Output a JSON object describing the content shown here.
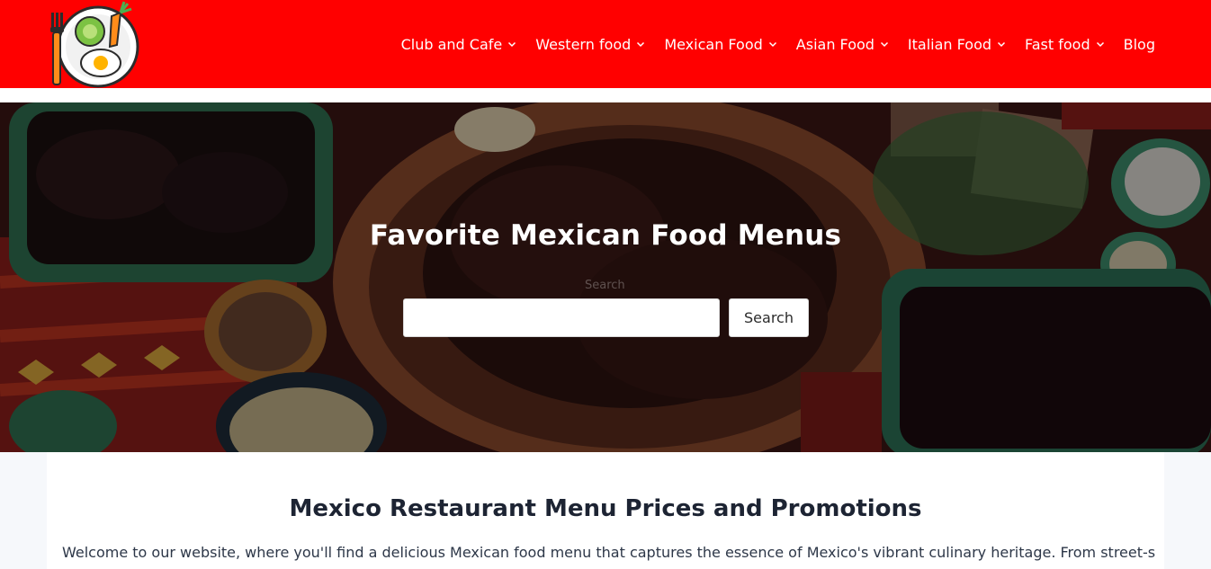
{
  "header": {
    "background": "#ff0000",
    "logo_icon": "food-plate-logo-icon",
    "nav": [
      {
        "label": "Club and Cafe",
        "has_dropdown": true
      },
      {
        "label": "Western food",
        "has_dropdown": true
      },
      {
        "label": "Mexican Food",
        "has_dropdown": true
      },
      {
        "label": "Asian Food",
        "has_dropdown": true
      },
      {
        "label": "Italian Food",
        "has_dropdown": true
      },
      {
        "label": "Fast food",
        "has_dropdown": true
      },
      {
        "label": "Blog",
        "has_dropdown": false
      }
    ]
  },
  "hero": {
    "title": "Favorite Mexican Food Menus",
    "search_label": "Search",
    "search_value": "",
    "search_button": "Search"
  },
  "content": {
    "heading": "Mexico Restaurant Menu Prices and Promotions",
    "intro": "Welcome to our website, where you'll find a delicious Mexican food menu that captures the essence of Mexico's vibrant culinary heritage. From street-style tacos"
  }
}
